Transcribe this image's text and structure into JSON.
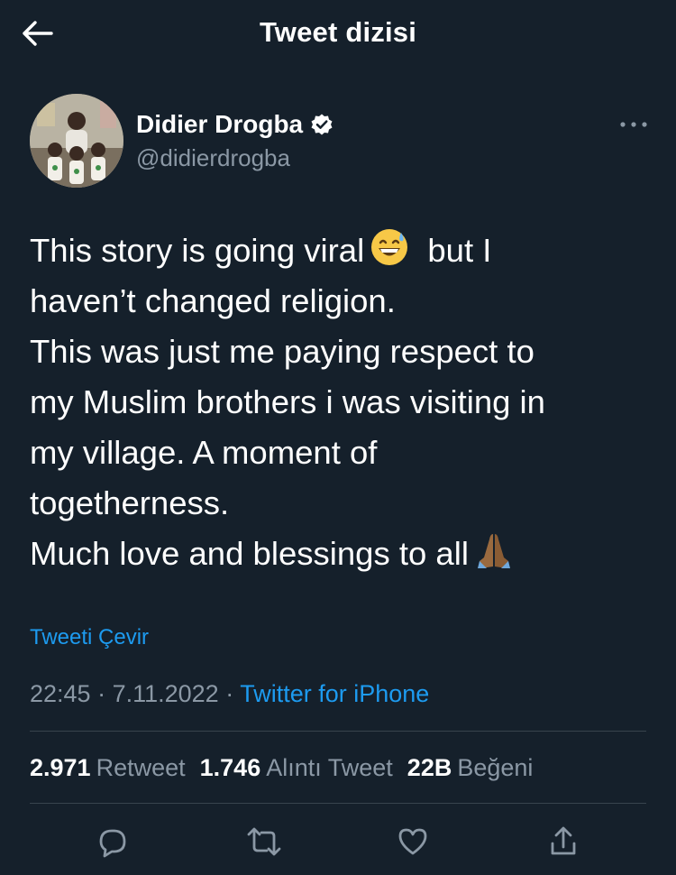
{
  "header": {
    "title": "Tweet dizisi",
    "back_icon": "arrow-left-icon"
  },
  "tweet": {
    "author": {
      "name": "Didier Drogba",
      "handle": "@didierdrogba",
      "verified_icon": "verified-badge-icon"
    },
    "text_parts": {
      "line1a": "This story is going viral",
      "line1b": "but I",
      "rest": "haven’t changed religion.\nThis was just me paying respect to\nmy Muslim brothers i was visiting in\nmy village. A moment of\ntogetherness.\nMuch love and blessings to all"
    },
    "emojis": [
      "grinning-sweat-emoji",
      "folded-hands-emoji"
    ],
    "translate_label": "Tweeti Çevir",
    "time": "22:45",
    "sep": " · ",
    "date": "7.11.2022",
    "source": "Twitter for iPhone"
  },
  "stats": [
    {
      "count": "2.971",
      "label": "Retweet"
    },
    {
      "count": "1.746",
      "label": "Alıntı Tweet"
    },
    {
      "count": "22B",
      "label": "Beğeni"
    }
  ],
  "actions": [
    "reply-icon",
    "retweet-icon",
    "like-icon",
    "share-icon"
  ],
  "colors": {
    "background": "#15202b",
    "accent": "#1d9bf0",
    "muted": "#8b98a5",
    "divider": "#38444d"
  }
}
